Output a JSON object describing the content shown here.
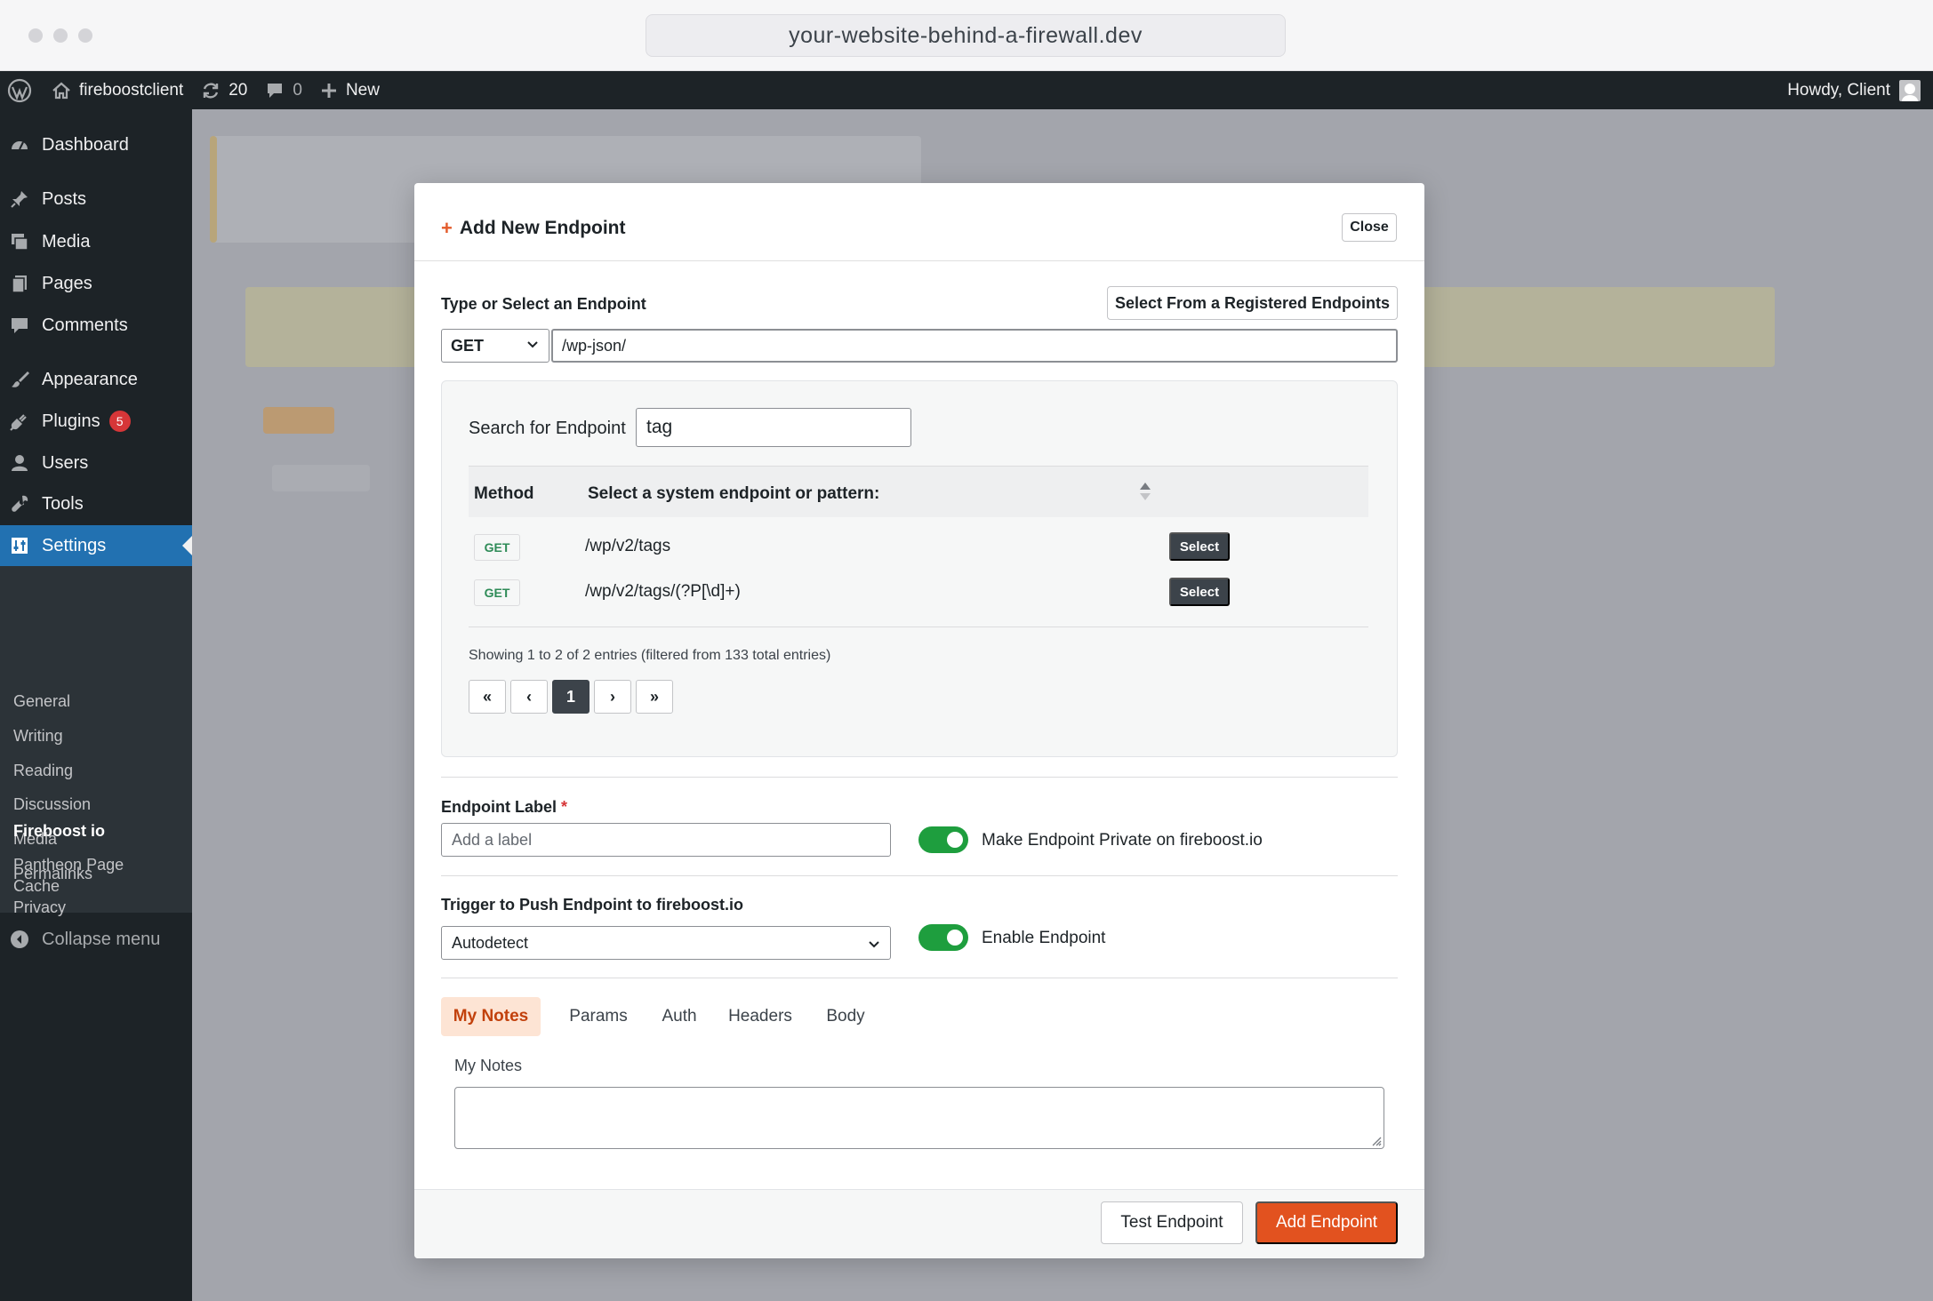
{
  "browser": {
    "url": "your-website-behind-a-firewall.dev"
  },
  "adminbar": {
    "site_name": "fireboostclient",
    "updates_count": "20",
    "comments_count": "0",
    "new_label": "New",
    "howdy": "Howdy, Client"
  },
  "sidebar": {
    "items": [
      {
        "label": "Dashboard",
        "icon": "dashboard-icon"
      },
      {
        "label": "Posts",
        "icon": "pin-icon"
      },
      {
        "label": "Media",
        "icon": "media-icon"
      },
      {
        "label": "Pages",
        "icon": "pages-icon"
      },
      {
        "label": "Comments",
        "icon": "comment-icon"
      },
      {
        "label": "Appearance",
        "icon": "brush-icon"
      },
      {
        "label": "Plugins",
        "icon": "plugin-icon",
        "badge": "5"
      },
      {
        "label": "Users",
        "icon": "user-icon"
      },
      {
        "label": "Tools",
        "icon": "wrench-icon"
      },
      {
        "label": "Settings",
        "icon": "settings-icon",
        "active": true
      }
    ],
    "submenu": [
      "General",
      "Writing",
      "Reading",
      "Discussion",
      "Media",
      "Permalinks",
      "Privacy",
      "Fireboost io",
      "Pantheon Page",
      "Cache"
    ],
    "collapse_label": "Collapse menu"
  },
  "modal": {
    "title": "Add New Endpoint",
    "close_label": "Close",
    "endpoint_section_label": "Type or Select an Endpoint",
    "registered_button": "Select From a Registered Endpoints",
    "method_value": "GET",
    "url_value": "/wp-json/",
    "search": {
      "label": "Search for Endpoint",
      "value": "tag"
    },
    "table": {
      "headers": [
        "Method",
        "Select a system endpoint or pattern:"
      ],
      "rows": [
        {
          "method": "GET",
          "endpoint": "/wp/v2/tags",
          "action": "Select"
        },
        {
          "method": "GET",
          "endpoint": "/wp/v2/tags/(?P[\\d]+)",
          "action": "Select"
        }
      ],
      "showing": "Showing 1 to 2 of 2 entries (filtered from 133 total entries)",
      "pagination": [
        "«",
        "‹",
        "1",
        "›",
        "»"
      ]
    },
    "label_field": {
      "label": "Endpoint Label",
      "required_mark": "*",
      "placeholder": "Add a label"
    },
    "private_toggle": {
      "label": "Make Endpoint Private on fireboost.io",
      "on": true
    },
    "trigger": {
      "label": "Trigger to Push Endpoint to fireboost.io",
      "value": "Autodetect"
    },
    "enable_toggle": {
      "label": "Enable Endpoint",
      "on": true
    },
    "tabs": [
      "My Notes",
      "Params",
      "Auth",
      "Headers",
      "Body"
    ],
    "notes_label": "My Notes",
    "test_button": "Test Endpoint",
    "add_button": "Add Endpoint"
  },
  "colors": {
    "accent": "#e2521f",
    "wp_blue": "#2271b1",
    "toggle_green": "#1e9e3e",
    "admin_dark": "#1d2327"
  }
}
